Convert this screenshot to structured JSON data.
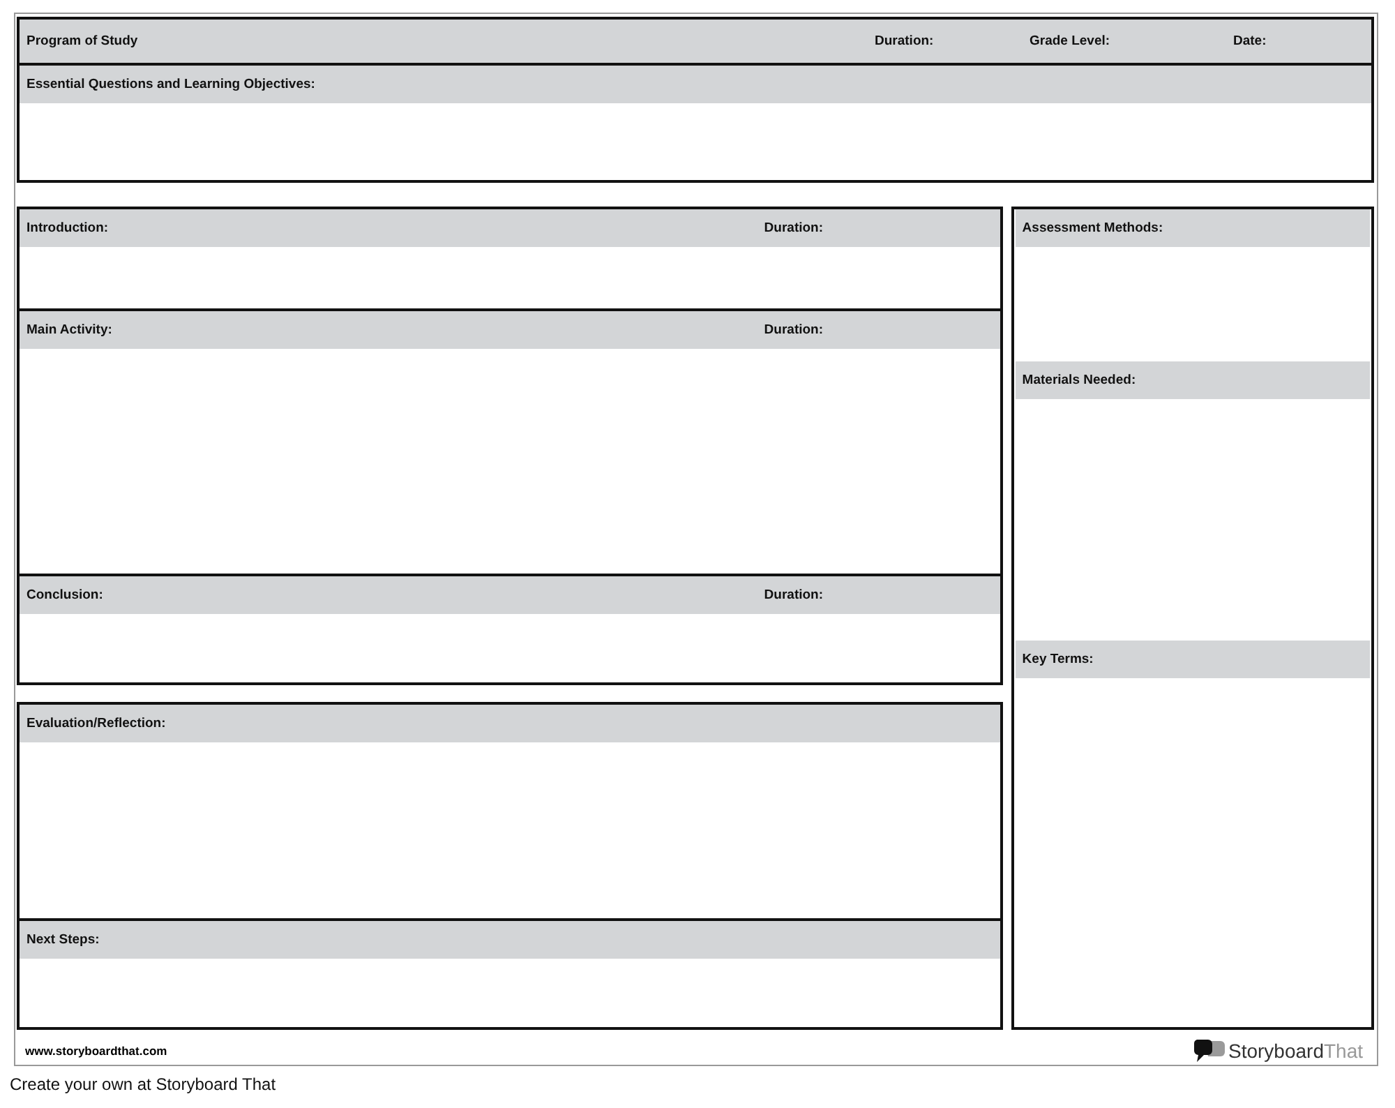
{
  "header": {
    "fields": [
      {
        "label": "Program of Study"
      },
      {
        "label": "Duration:"
      },
      {
        "label": "Grade Level:"
      },
      {
        "label": "Date:"
      }
    ],
    "objectives": {
      "label": "Essential Questions and Learning Objectives:"
    }
  },
  "left_boxes": [
    {
      "sections": [
        {
          "label": "Introduction:",
          "duration": "Duration:"
        },
        {
          "label": "Main Activity:",
          "duration": "Duration:"
        },
        {
          "label": "Conclusion:",
          "duration": "Duration:"
        }
      ]
    },
    {
      "sections": [
        {
          "label": "Evaluation/Reflection:"
        },
        {
          "label": "Next Steps:"
        }
      ]
    }
  ],
  "right_box": {
    "sections": [
      {
        "label": "Assessment Methods:"
      },
      {
        "label": "Materials Needed:"
      },
      {
        "label": "Key Terms:"
      }
    ]
  },
  "footer": {
    "website": "www.storyboardthat.com",
    "logo_parts": [
      "Storyboard",
      "That"
    ]
  },
  "caption": "Create your own at Storyboard That"
}
